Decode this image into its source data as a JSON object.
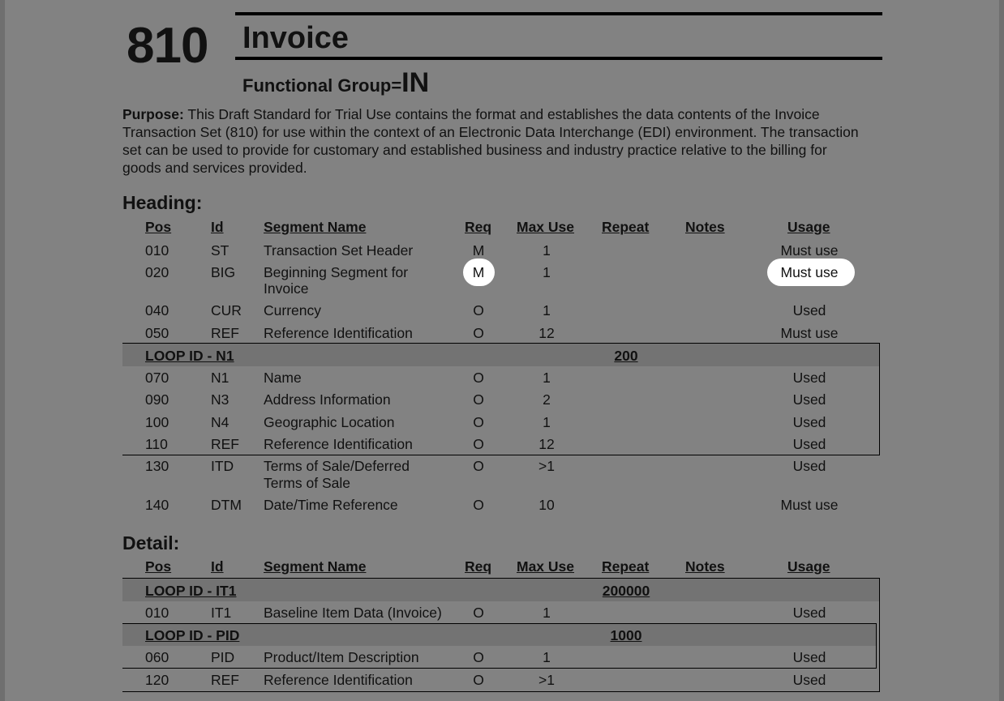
{
  "doc": {
    "number": "810",
    "title": "Invoice",
    "functional_group_label": "Functional Group=",
    "functional_group_code": "IN",
    "purpose_label": "Purpose:",
    "purpose_lines": [
      "This Draft Standard for Trial Use contains the format and establishes the data contents of the Invoice",
      "Transaction Set (810) for use within the context of an Electronic Data Interchange (EDI) environment. The transaction",
      "set can be used to provide for customary and established business and industry practice relative to the billing for",
      "goods and services provided."
    ]
  },
  "columns": {
    "pos": "Pos",
    "id": "Id",
    "segment_name": "Segment Name",
    "req": "Req",
    "max_use": "Max Use",
    "repeat": "Repeat",
    "notes": "Notes",
    "usage": "Usage"
  },
  "heading": {
    "label": "Heading:",
    "rows": [
      {
        "pos": "010",
        "id": "ST",
        "name": "Transaction Set Header",
        "req": "M",
        "max": "1",
        "usage": "Must use"
      },
      {
        "pos": "020",
        "id": "BIG",
        "name": "Beginning Segment for",
        "name2": "Invoice",
        "req": "M",
        "max": "1",
        "usage": "Must use"
      },
      {
        "pos": "040",
        "id": "CUR",
        "name": "Currency",
        "req": "O",
        "max": "1",
        "usage": "Used"
      },
      {
        "pos": "050",
        "id": "REF",
        "name": "Reference Identification",
        "req": "O",
        "max": "12",
        "usage": "Must use"
      },
      {
        "pos": "070",
        "id": "N1",
        "name": "Name",
        "req": "O",
        "max": "1",
        "usage": "Used"
      },
      {
        "pos": "090",
        "id": "N3",
        "name": "Address Information",
        "req": "O",
        "max": "2",
        "usage": "Used"
      },
      {
        "pos": "100",
        "id": "N4",
        "name": "Geographic Location",
        "req": "O",
        "max": "1",
        "usage": "Used"
      },
      {
        "pos": "110",
        "id": "REF",
        "name": "Reference Identification",
        "req": "O",
        "max": "12",
        "usage": "Used"
      },
      {
        "pos": "130",
        "id": "ITD",
        "name": "Terms of Sale/Deferred",
        "name2": "Terms of Sale",
        "req": "O",
        "max": ">1",
        "usage": "Used"
      },
      {
        "pos": "140",
        "id": "DTM",
        "name": "Date/Time Reference",
        "req": "O",
        "max": "10",
        "usage": "Must use"
      }
    ],
    "loop_n1": {
      "label": "LOOP ID - N1",
      "repeat": "200"
    }
  },
  "detail": {
    "label": "Detail:",
    "loop_it1": {
      "label": "LOOP ID - IT1",
      "repeat": "200000"
    },
    "loop_pid": {
      "label": "LOOP ID - PID",
      "repeat": "1000"
    },
    "rows": [
      {
        "pos": "010",
        "id": "IT1",
        "name": "Baseline Item Data (Invoice)",
        "req": "O",
        "max": "1",
        "usage": "Used"
      },
      {
        "pos": "060",
        "id": "PID",
        "name": "Product/Item Description",
        "req": "O",
        "max": "1",
        "usage": "Used"
      },
      {
        "pos": "120",
        "id": "REF",
        "name": "Reference Identification",
        "req": "O",
        "max": ">1",
        "usage": "Used"
      }
    ]
  }
}
